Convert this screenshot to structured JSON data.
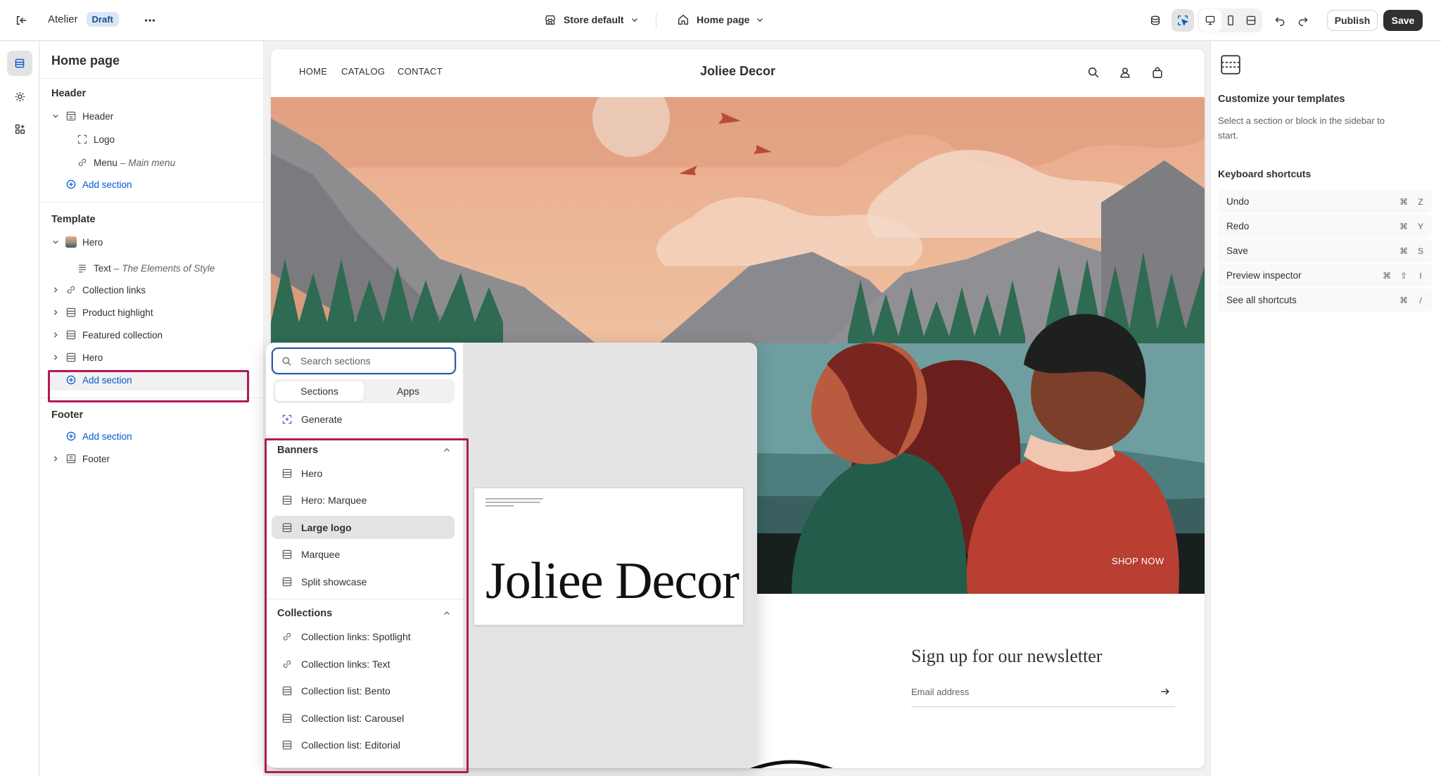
{
  "topbar": {
    "app_name": "Atelier",
    "status_badge": "Draft",
    "store_selector": "Store default",
    "page_selector": "Home page",
    "publish_label": "Publish",
    "save_label": "Save"
  },
  "sidebar": {
    "page_title": "Home page",
    "header_group": {
      "title": "Header",
      "items": [
        {
          "label": "Header",
          "detail": ""
        },
        {
          "label": "Logo",
          "detail": ""
        },
        {
          "label": "Menu",
          "detail": "Main menu"
        }
      ],
      "add_label": "Add section"
    },
    "template_group": {
      "title": "Template",
      "hero_label": "Hero",
      "text_label": "Text",
      "text_detail": "The Elements of Style",
      "items": [
        "Collection links",
        "Product highlight",
        "Featured collection",
        "Hero"
      ],
      "add_label": "Add section"
    },
    "footer_group": {
      "title": "Footer",
      "add_label": "Add section",
      "footer_label": "Footer"
    }
  },
  "store": {
    "nav": [
      "HOME",
      "CATALOG",
      "CONTACT"
    ],
    "brand": "Joliee Decor",
    "hero_cta": "SHOP NOW",
    "newsletter_title": "Sign up for our newsletter",
    "email_placeholder": "Email address"
  },
  "picker": {
    "search_placeholder": "Search sections",
    "tabs": [
      "Sections",
      "Apps"
    ],
    "generate_label": "Generate",
    "banners_title": "Banners",
    "banners": [
      "Hero",
      "Hero: Marquee",
      "Large logo",
      "Marquee",
      "Split showcase"
    ],
    "collections_title": "Collections",
    "collections": [
      "Collection links: Spotlight",
      "Collection links: Text",
      "Collection list: Bento",
      "Collection list: Carousel",
      "Collection list: Editorial"
    ],
    "preview_brand": "Joliee Decor",
    "selected_item": "Large logo"
  },
  "inspector": {
    "title": "Customize your templates",
    "description": "Select a section or block in the sidebar to start.",
    "shortcuts_title": "Keyboard shortcuts",
    "shortcuts": [
      {
        "label": "Undo",
        "keys": [
          "⌘",
          "Z"
        ]
      },
      {
        "label": "Redo",
        "keys": [
          "⌘",
          "Y"
        ]
      },
      {
        "label": "Save",
        "keys": [
          "⌘",
          "S"
        ]
      },
      {
        "label": "Preview inspector",
        "keys": [
          "⌘",
          "⇧",
          "I"
        ]
      },
      {
        "label": "See all shortcuts",
        "keys": [
          "⌘",
          "/"
        ]
      }
    ]
  },
  "colors": {
    "accent": "#005bd3",
    "highlight": "#b3195a",
    "save_bg": "#303030"
  }
}
